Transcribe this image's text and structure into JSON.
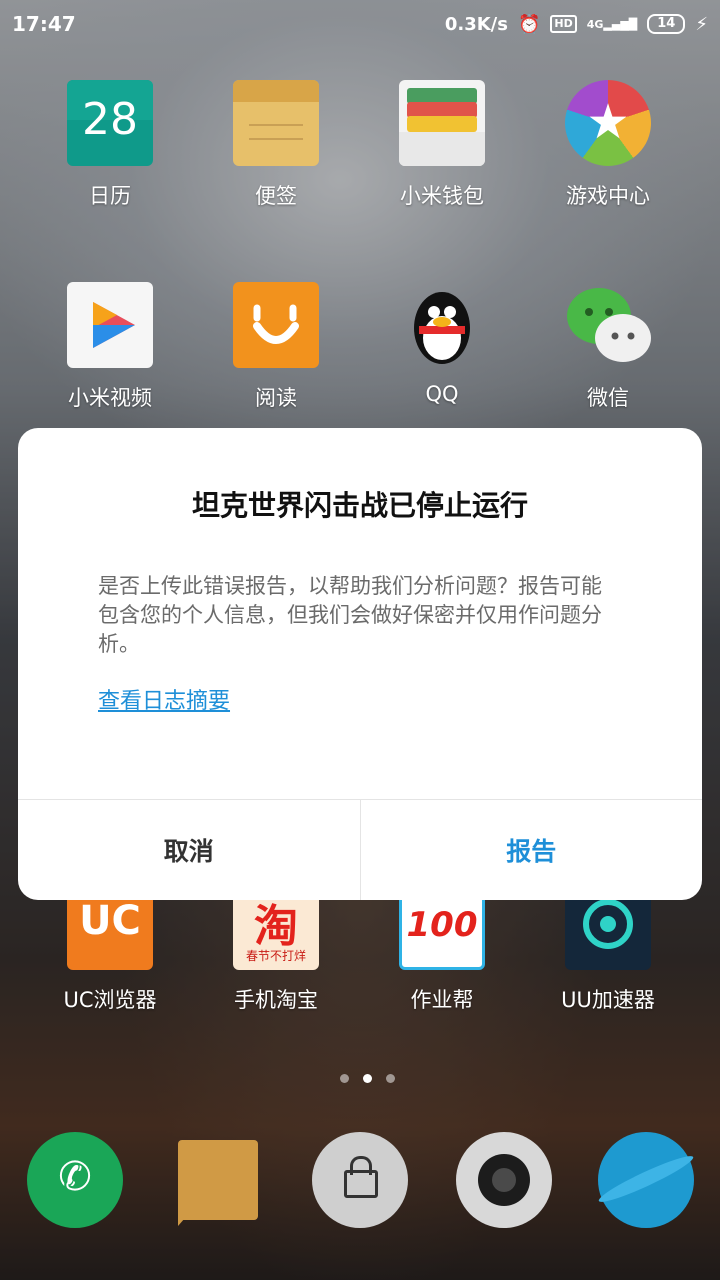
{
  "status_bar": {
    "time": "17:47",
    "speed": "0.3K/s",
    "hd": "HD",
    "network": "4G",
    "battery": "14"
  },
  "home_apps": [
    {
      "label": "日历",
      "icon": "calendar-icon",
      "badge_text": "28"
    },
    {
      "label": "便签",
      "icon": "notes-icon"
    },
    {
      "label": "小米钱包",
      "icon": "wallet-icon"
    },
    {
      "label": "游戏中心",
      "icon": "game-center-icon"
    },
    {
      "label": "小米视频",
      "icon": "video-icon"
    },
    {
      "label": "阅读",
      "icon": "reader-icon"
    },
    {
      "label": "QQ",
      "icon": "qq-icon"
    },
    {
      "label": "微信",
      "icon": "wechat-icon"
    },
    {
      "label": "UC浏览器",
      "icon": "uc-browser-icon"
    },
    {
      "label": "手机淘宝",
      "icon": "taobao-icon",
      "badge_text": "淘",
      "sub_text": "春节不打烊"
    },
    {
      "label": "作业帮",
      "icon": "zuoyebang-icon",
      "badge_text": "100"
    },
    {
      "label": "UU加速器",
      "icon": "uu-accelerator-icon"
    }
  ],
  "dock": [
    "phone-icon",
    "messages-icon",
    "lock-icon",
    "camera-icon",
    "browser-icon"
  ],
  "dialog": {
    "title": "坦克世界闪击战已停止运行",
    "body": "是否上传此错误报告，以帮助我们分析问题？报告可能包含您的个人信息，但我们会做好保密并仅用作问题分析。",
    "link": "查看日志摘要",
    "cancel": "取消",
    "confirm": "报告"
  },
  "colors": {
    "accent": "#1e8fd8",
    "dialog_bg": "#ffffff"
  }
}
